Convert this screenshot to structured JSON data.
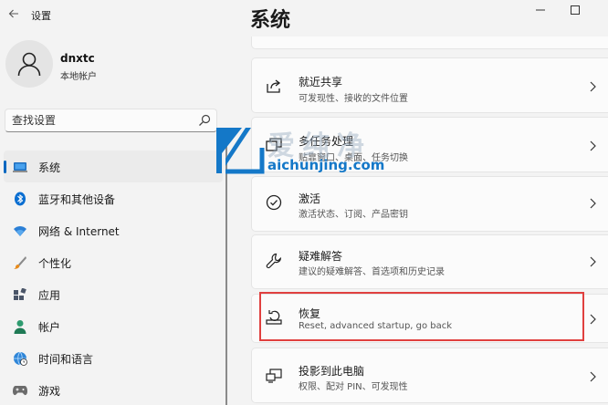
{
  "window": {
    "app_title": "设置"
  },
  "profile": {
    "name": "dnxtc",
    "account_type": "本地帐户"
  },
  "search": {
    "placeholder": "查找设置"
  },
  "nav": {
    "items": [
      {
        "label": "系统",
        "icon": "laptop-icon",
        "selected": true
      },
      {
        "label": "蓝牙和其他设备",
        "icon": "bluetooth-icon"
      },
      {
        "label": "网络 & Internet",
        "icon": "wifi-icon"
      },
      {
        "label": "个性化",
        "icon": "brush-icon"
      },
      {
        "label": "应用",
        "icon": "apps-icon"
      },
      {
        "label": "帐户",
        "icon": "person-icon"
      },
      {
        "label": "时间和语言",
        "icon": "globe-clock-icon"
      },
      {
        "label": "游戏",
        "icon": "gamepad-icon"
      }
    ]
  },
  "main": {
    "title": "系统",
    "cards": [
      {
        "title": "就近共享",
        "subtitle": "可发现性、接收的文件位置",
        "icon": "share-icon"
      },
      {
        "title": "多任务处理",
        "subtitle": "贴靠窗口、桌面、任务切换",
        "icon": "multitask-icon"
      },
      {
        "title": "激活",
        "subtitle": "激活状态、订阅、产品密钥",
        "icon": "check-circle-icon"
      },
      {
        "title": "疑难解答",
        "subtitle": "建议的疑难解答、首选项和历史记录",
        "icon": "wrench-icon"
      },
      {
        "title": "恢复",
        "subtitle": "Reset, advanced startup, go back",
        "icon": "recovery-icon"
      },
      {
        "title": "投影到此电脑",
        "subtitle": "权限、配对 PIN、可发现性",
        "icon": "project-icon"
      }
    ]
  },
  "watermark": {
    "brand": "爱纯净",
    "url": "aichunjing.com"
  },
  "colors": {
    "accent": "#0067c0",
    "highlight": "#e0403f",
    "background": "#f3f3f3",
    "card": "#fbfbfb"
  }
}
